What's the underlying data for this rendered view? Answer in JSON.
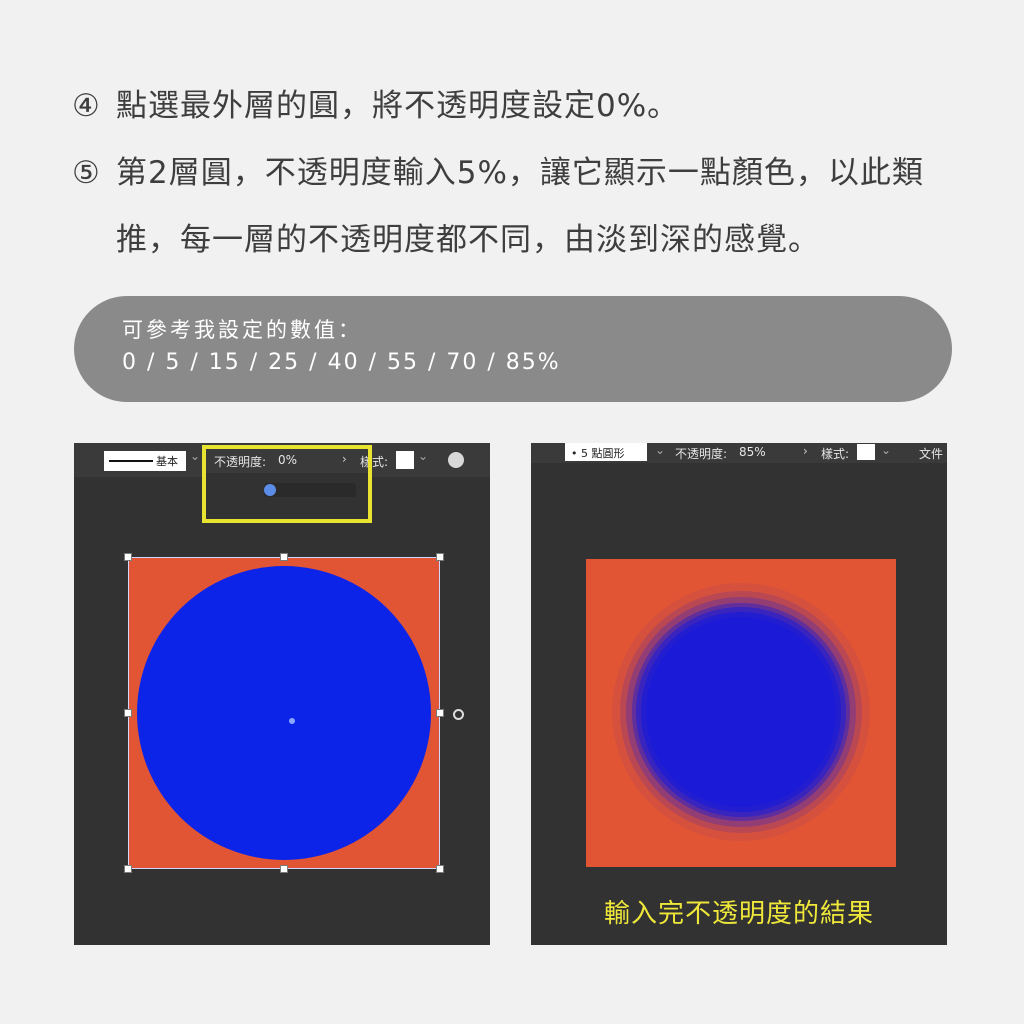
{
  "steps": {
    "step4": {
      "num": "④",
      "text": "點選最外層的圓，將不透明度設定0%。"
    },
    "step5": {
      "num": "⑤",
      "line1": "第2層圓，不透明度輸入5%，讓它顯示一點顏色，以此類",
      "line2": "推，每一層的不透明度都不同，由淡到深的感覺。"
    }
  },
  "reference": {
    "title": "可參考我設定的數值：",
    "values": "0 / 5 / 15 / 25 / 40 / 55 / 70 / 85%"
  },
  "left_panel": {
    "stroke_label": "基本",
    "opacity_label": "不透明度:",
    "opacity_value": "0%",
    "opacity_slider_level": 0,
    "style_label": "樣式:",
    "chevron": "›",
    "dropdown": "⌄"
  },
  "right_panel": {
    "point_label": "• 5 點圓形",
    "opacity_label": "不透明度:",
    "opacity_value": "85%",
    "style_label": "樣式:",
    "doc_label": "文件",
    "chevron": "›",
    "dropdown": "⌄",
    "caption": "輸入完不透明度的結果"
  },
  "colors": {
    "background": "#f1f1f2",
    "panel": "#323232",
    "artboard_orange": "#e15535",
    "circle_blue": "#0c24e8",
    "highlight_yellow": "#e8e331",
    "caption_yellow": "#efe83a"
  }
}
